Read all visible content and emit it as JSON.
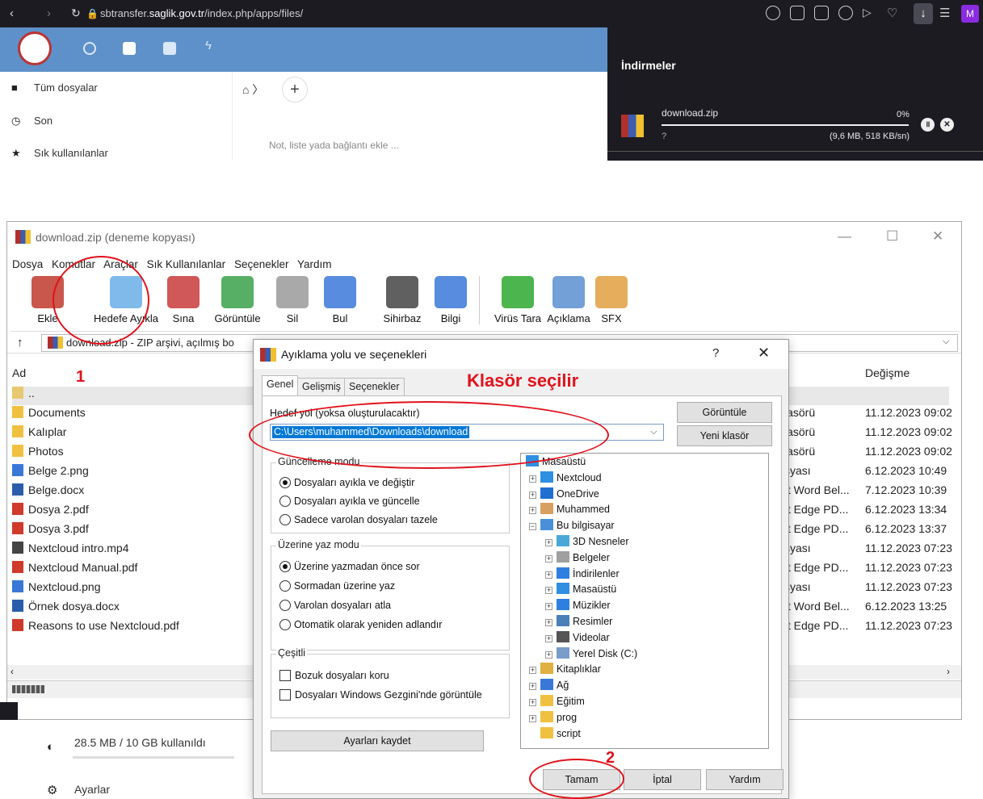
{
  "browser": {
    "url_prefix": "sbtransfer.",
    "url_domain": "saglik.gov.tr",
    "url_path": "/index.php/apps/files/",
    "avatar_letter": "M"
  },
  "nextcloud": {
    "sidebar": [
      {
        "label": "Tüm dosyalar",
        "icon": "folder-icon"
      },
      {
        "label": "Son",
        "icon": "clock-icon"
      },
      {
        "label": "Sık kullanılanlar",
        "icon": "star-icon"
      }
    ],
    "note_placeholder": "Not, liste yada bağlantı ekle ...",
    "usage": "28.5 MB / 10 GB kullanıldı",
    "settings": "Ayarlar"
  },
  "downloads": {
    "title": "İndirmeler",
    "file": "download.zip",
    "percent": "0%",
    "progress": 0,
    "size_speed": "(9,6 MB, 518 KB/sn)",
    "remaining": "?"
  },
  "winrar": {
    "title": "download.zip (deneme kopyası)",
    "menu": [
      "Dosya",
      "Komutlar",
      "Araçlar",
      "Sık Kullanılanlar",
      "Seçenekler",
      "Yardım"
    ],
    "toolbar": [
      {
        "label": "Ekle",
        "icon": "add-archive-icon",
        "color": "#c0392b"
      },
      {
        "label": "Hedefe Ayıkla",
        "icon": "extract-folder-icon",
        "color": "#6aaee8"
      },
      {
        "label": "Sına",
        "icon": "test-icon",
        "color": "#c93b3b"
      },
      {
        "label": "Görüntüle",
        "icon": "view-book-icon",
        "color": "#3aa14a"
      },
      {
        "label": "Sil",
        "icon": "trash-icon",
        "color": "#9a9a9a"
      },
      {
        "label": "Bul",
        "icon": "magnifier-icon",
        "color": "#3a78d8"
      },
      {
        "label": "Sihirbaz",
        "icon": "wand-icon",
        "color": "#444444"
      },
      {
        "label": "Bilgi",
        "icon": "info-icon",
        "color": "#3a78d8"
      },
      {
        "label": "Virüs Tara",
        "icon": "virus-scan-icon",
        "color": "#2ea82e"
      },
      {
        "label": "Açıklama",
        "icon": "comment-icon",
        "color": "#5b8fcf"
      },
      {
        "label": "SFX",
        "icon": "sfx-box-icon",
        "color": "#e0a040"
      }
    ],
    "address": "download.zip - ZIP arşivi, açılmış bo",
    "col_name": "Ad",
    "col_modified": "Değişme",
    "files": [
      {
        "name": "..",
        "type": "",
        "date": "",
        "icon": "folder-up-icon"
      },
      {
        "name": "Documents",
        "type": "lasörü",
        "date": "11.12.2023 09:02",
        "icon": "folder-icon"
      },
      {
        "name": "Kalıplar",
        "type": "lasörü",
        "date": "11.12.2023 09:02",
        "icon": "folder-icon"
      },
      {
        "name": "Photos",
        "type": "lasörü",
        "date": "11.12.2023 09:02",
        "icon": "folder-icon"
      },
      {
        "name": "Belge 2.png",
        "type": "syası",
        "date": "6.12.2023 10:49",
        "icon": "image-file-icon"
      },
      {
        "name": "Belge.docx",
        "type": "ft Word Bel...",
        "date": "7.12.2023 10:39",
        "icon": "word-file-icon"
      },
      {
        "name": "Dosya 2.pdf",
        "type": "ft Edge PD...",
        "date": "6.12.2023 13:34",
        "icon": "pdf-file-icon"
      },
      {
        "name": "Dosya 3.pdf",
        "type": "ft Edge PD...",
        "date": "6.12.2023 13:37",
        "icon": "pdf-file-icon"
      },
      {
        "name": "Nextcloud intro.mp4",
        "type": "syası",
        "date": "11.12.2023 07:23",
        "icon": "video-file-icon"
      },
      {
        "name": "Nextcloud Manual.pdf",
        "type": "ft Edge PD...",
        "date": "11.12.2023 07:23",
        "icon": "pdf-file-icon"
      },
      {
        "name": "Nextcloud.png",
        "type": "syası",
        "date": "11.12.2023 07:23",
        "icon": "image-file-icon"
      },
      {
        "name": "Örnek dosya.docx",
        "type": "ft Word Bel...",
        "date": "6.12.2023 13:25",
        "icon": "word-file-icon"
      },
      {
        "name": "Reasons to use Nextcloud.pdf",
        "type": "ft Edge PD...",
        "date": "11.12.2023 07:23",
        "icon": "pdf-file-icon"
      }
    ]
  },
  "dialog": {
    "title": "Ayıklama yolu ve seçenekleri",
    "help": "?",
    "tabs": [
      "Genel",
      "Gelişmiş",
      "Seçenekler"
    ],
    "dest_label": "Hedef yol (yoksa oluşturulacaktır)",
    "dest_value": "C:\\Users\\muhammed\\Downloads\\download",
    "btn_view": "Görüntüle",
    "btn_newfolder": "Yeni klasör",
    "update_group": "Güncelleme modu",
    "update_opts": [
      "Dosyaları ayıkla ve değiştir",
      "Dosyaları ayıkla ve güncelle",
      "Sadece varolan dosyaları tazele"
    ],
    "overwrite_group": "Üzerine yaz modu",
    "overwrite_opts": [
      "Üzerine yazmadan önce sor",
      "Sormadan üzerine yaz",
      "Varolan dosyaları atla",
      "Otomatik olarak yeniden adlandır"
    ],
    "misc_group": "Çeşitli",
    "misc_opts": [
      "Bozuk dosyaları koru",
      "Dosyaları Windows Gezgini'nde görüntüle"
    ],
    "btn_save": "Ayarları kaydet",
    "tree": [
      {
        "label": "Masaüstü",
        "level": 0,
        "pm": "",
        "icon": "desktop-icon",
        "color": "#2f8fe0"
      },
      {
        "label": "Nextcloud",
        "level": 1,
        "pm": "+",
        "icon": "nextcloud-icon",
        "color": "#2f8fe0"
      },
      {
        "label": "OneDrive",
        "level": 1,
        "pm": "+",
        "icon": "cloud-icon",
        "color": "#1f6fd0"
      },
      {
        "label": "Muhammed",
        "level": 1,
        "pm": "+",
        "icon": "user-icon",
        "color": "#d8a060"
      },
      {
        "label": "Bu bilgisayar",
        "level": 1,
        "pm": "-",
        "icon": "computer-icon",
        "color": "#4a90d9"
      },
      {
        "label": "3D Nesneler",
        "level": 2,
        "pm": "+",
        "icon": "cube-icon",
        "color": "#4aa8d8"
      },
      {
        "label": "Belgeler",
        "level": 2,
        "pm": "+",
        "icon": "documents-icon",
        "color": "#a0a0a0"
      },
      {
        "label": "İndirilenler",
        "level": 2,
        "pm": "+",
        "icon": "download-arrow-icon",
        "color": "#2f7fe0"
      },
      {
        "label": "Masaüstü",
        "level": 2,
        "pm": "+",
        "icon": "desktop-icon",
        "color": "#2f8fe0"
      },
      {
        "label": "Müzikler",
        "level": 2,
        "pm": "+",
        "icon": "music-icon",
        "color": "#2f7fe0"
      },
      {
        "label": "Resimler",
        "level": 2,
        "pm": "+",
        "icon": "pictures-icon",
        "color": "#4a7fb8"
      },
      {
        "label": "Videolar",
        "level": 2,
        "pm": "+",
        "icon": "video-icon",
        "color": "#555555"
      },
      {
        "label": "Yerel Disk (C:)",
        "level": 2,
        "pm": "+",
        "icon": "disk-icon",
        "color": "#7a9cc9"
      },
      {
        "label": "Kitaplıklar",
        "level": 1,
        "pm": "+",
        "icon": "library-icon",
        "color": "#e0b040"
      },
      {
        "label": "Ağ",
        "level": 1,
        "pm": "+",
        "icon": "network-icon",
        "color": "#3a78d8"
      },
      {
        "label": "Eğitim",
        "level": 1,
        "pm": "+",
        "icon": "folder-icon",
        "color": "#f0c040"
      },
      {
        "label": "prog",
        "level": 1,
        "pm": "+",
        "icon": "folder-icon",
        "color": "#f0c040"
      },
      {
        "label": "script",
        "level": 1,
        "pm": "",
        "icon": "folder-icon",
        "color": "#f0c040"
      }
    ],
    "btn_ok": "Tamam",
    "btn_cancel": "İptal",
    "btn_help": "Yardım"
  },
  "annotations": {
    "step1": "1",
    "step2": "2",
    "folder_note": "Klasör seçilir",
    "color": "#e0121c"
  }
}
